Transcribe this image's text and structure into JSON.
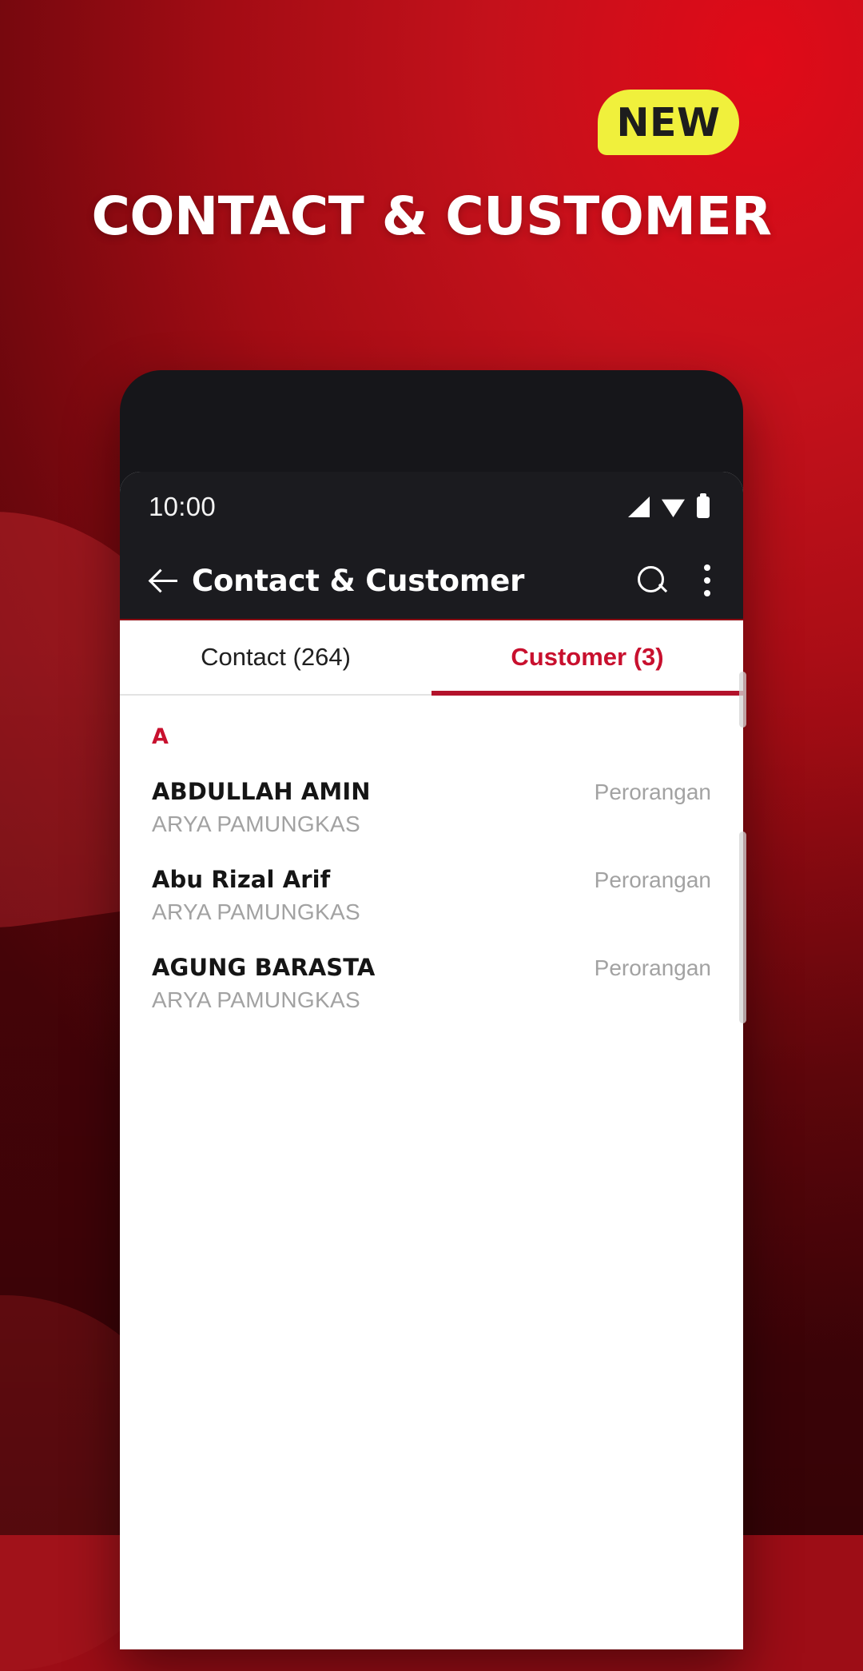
{
  "promo": {
    "badge_label": "NEW",
    "headline": "CONTACT & CUSTOMER",
    "badge_color": "#F0F03C",
    "background_color": "#9D0D16",
    "headline_color": "#FFFFFF"
  },
  "phone": {
    "status_bar": {
      "time": "10:00",
      "icons": [
        "signal-icon",
        "wifi-icon",
        "battery-icon"
      ]
    },
    "app_bar": {
      "back_icon": "back-arrow-icon",
      "title": "Contact & Customer",
      "search_icon": "search-icon",
      "overflow_icon": "overflow-menu-icon"
    },
    "tabs": [
      {
        "label": "Contact (264)",
        "active": false
      },
      {
        "label": "Customer (3)",
        "active": true
      }
    ],
    "accent_color": "#C8102E",
    "list": {
      "section_header": "A",
      "items": [
        {
          "name": "ABDULLAH AMIN",
          "subtitle": "ARYA PAMUNGKAS",
          "type": "Perorangan"
        },
        {
          "name": "Abu Rizal Arif",
          "subtitle": "ARYA PAMUNGKAS",
          "type": "Perorangan"
        },
        {
          "name": "AGUNG BARASTA",
          "subtitle": "ARYA PAMUNGKAS",
          "type": "Perorangan"
        }
      ]
    }
  }
}
